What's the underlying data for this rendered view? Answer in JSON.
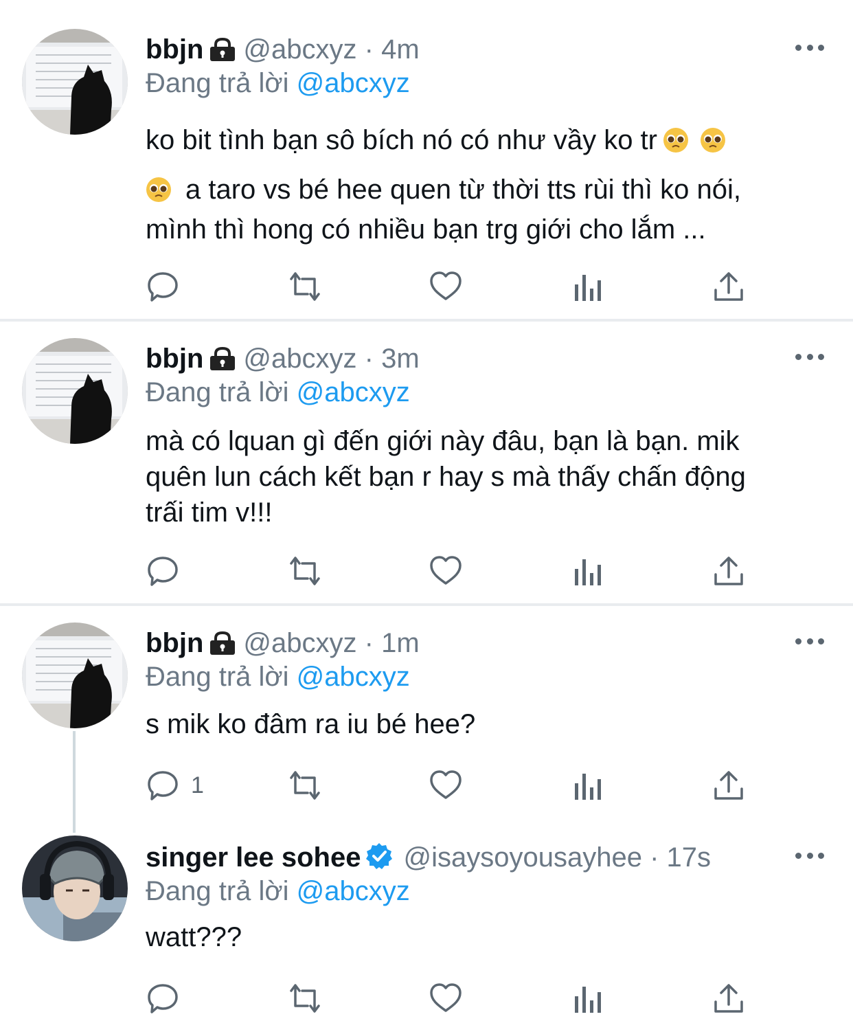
{
  "tweets": [
    {
      "name": "bbjn",
      "handle": "@abcxyz",
      "sep": "·",
      "time": "4m",
      "replying_prefix": "Đang trả lời",
      "replying_to": "@abcxyz",
      "line1": "ko bit tình bạn sô bích nó có như vầy ko tr",
      "line2": "a taro vs bé hee quen từ thời tts rùi thì ko nói,",
      "line3": "mình thì hong có nhiều bạn trg giới cho lắm ...",
      "reply_count": ""
    },
    {
      "name": "bbjn",
      "handle": "@abcxyz",
      "sep": "·",
      "time": "3m",
      "replying_prefix": "Đang trả lời",
      "replying_to": "@abcxyz",
      "line1": "mà có lquan gì đến giới này đâu, bạn là bạn. mik",
      "line2": "quên lun cách kết bạn r hay s mà thấy chấn động",
      "line3": "trấi tim v!!!",
      "reply_count": ""
    },
    {
      "name": "bbjn",
      "handle": "@abcxyz",
      "sep": "·",
      "time": "1m",
      "replying_prefix": "Đang trả lời",
      "replying_to": "@abcxyz",
      "line1": "s mik ko đâm ra iu bé hee?",
      "reply_count": "1"
    },
    {
      "name": "singer lee sohee",
      "handle": "@isaysoyousayhee",
      "sep": "·",
      "time": "17s",
      "replying_prefix": "Đang trả lời",
      "replying_to": "@abcxyz",
      "line1": "watt???",
      "reply_count": ""
    }
  ],
  "icons": {
    "lock": "lock-icon",
    "verified": "verified-badge-icon",
    "more": "more-options-icon",
    "reply": "reply-icon",
    "retweet": "retweet-icon",
    "like": "like-icon",
    "views": "views-icon",
    "share": "share-icon",
    "emoji": "pleading-face-emoji"
  },
  "colors": {
    "mention": "#1d9bf0",
    "secondary_text": "#6b7885",
    "verified": "#1d9bf0",
    "divider": "#e9ecef"
  }
}
